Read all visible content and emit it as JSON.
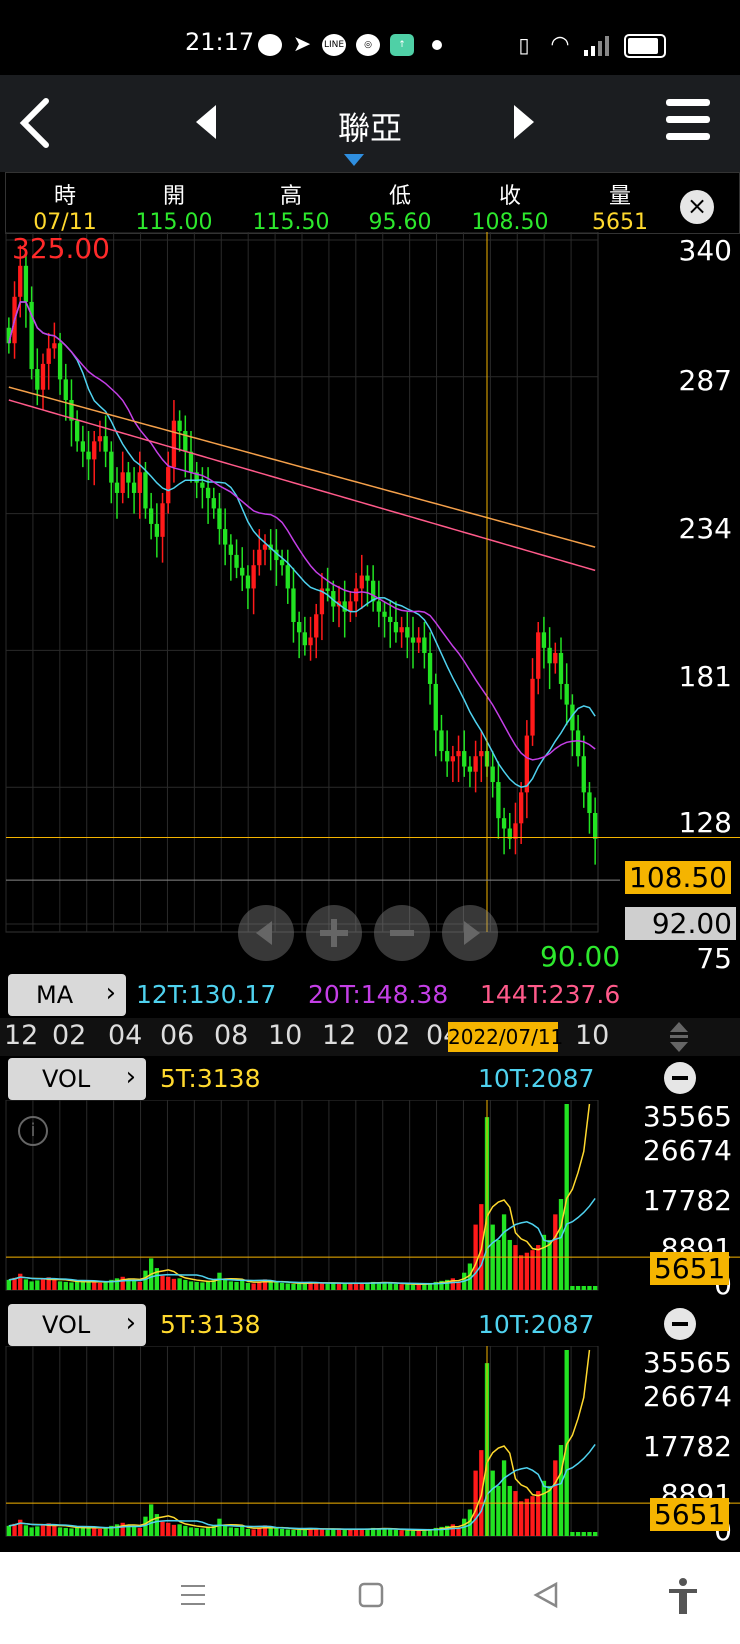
{
  "status_bar": {
    "time": "21:17",
    "icons": [
      "discord-icon",
      "telegram-icon",
      "line-icon",
      "app-icon",
      "green-app-icon",
      "dot-icon",
      "vibrate-icon",
      "wifi-icon",
      "signal-icon",
      "battery-icon"
    ]
  },
  "nav": {
    "title": "聯亞",
    "back_icon": "back-chevron-icon",
    "prev_icon": "prev-triangle-icon",
    "next_icon": "next-triangle-icon",
    "menu_icon": "hamburger-menu-icon"
  },
  "quote": {
    "headers": [
      "時",
      "開",
      "高",
      "低",
      "收",
      "量"
    ],
    "values": [
      "07/11",
      "115.00",
      "115.50",
      "95.60",
      "108.50",
      "5651"
    ],
    "value_colors": [
      "#ffd92e",
      "#2de82d",
      "#2de82d",
      "#2de82d",
      "#2de82d",
      "#ffd92e"
    ]
  },
  "chart": {
    "max_label": "325.00",
    "min_label": "90.00",
    "yaxis": [
      "340",
      "287",
      "234",
      "181",
      "128",
      "75"
    ],
    "price_tag": "108.50",
    "cursor_tag": "92.00",
    "xaxis": [
      "12",
      "02",
      "04",
      "06",
      "08",
      "10",
      "12",
      "02",
      "04",
      "10"
    ],
    "cursor_date": "2022/07/11"
  },
  "ma": {
    "button": "MA",
    "ma12": "12T:130.17",
    "ma20": "20T:148.38",
    "ma144": "144T:237.6",
    "color12": "#4fd2ef",
    "color20": "#c43fe6",
    "color144": "#ff5a8a"
  },
  "vol1": {
    "button": "VOL",
    "ma5": "5T:3138",
    "ma10": "10T:2087",
    "axis": [
      "35565",
      "26674",
      "17782",
      "8891",
      "0"
    ],
    "tag": "5651"
  },
  "vol2": {
    "button": "VOL",
    "ma5": "5T:3138",
    "ma10": "10T:2087",
    "axis": [
      "35565",
      "26674",
      "17782",
      "8891",
      "0"
    ],
    "tag": "5651"
  },
  "bottom_nav": [
    "menu-lines-icon",
    "home-square-icon",
    "back-triangle-icon",
    "accessibility-icon"
  ],
  "colors": {
    "up": "#ff1a1a",
    "down": "#22e322",
    "accent": "#f5b400"
  },
  "chart_data": {
    "type": "candlestick",
    "title": "聯亞",
    "ylim": [
      75,
      340
    ],
    "close": [
      300,
      318,
      330,
      316,
      290,
      282,
      292,
      298,
      300,
      286,
      278,
      270,
      262,
      258,
      255,
      262,
      264,
      258,
      246,
      242,
      250,
      246,
      242,
      250,
      236,
      230,
      225,
      238,
      252,
      270,
      266,
      258,
      250,
      246,
      244,
      240,
      236,
      228,
      222,
      218,
      213,
      210,
      205,
      214,
      220,
      222,
      220,
      216,
      214,
      205,
      192,
      188,
      183,
      186,
      195,
      205,
      204,
      198,
      200,
      196,
      200,
      205,
      210,
      208,
      200,
      196,
      194,
      192,
      188,
      190,
      186,
      184,
      186,
      180,
      168,
      150,
      142,
      138,
      140,
      142,
      136,
      134,
      140,
      142,
      136,
      130,
      116,
      112,
      108,
      114,
      126,
      148,
      170,
      188,
      182,
      176,
      180,
      168,
      160,
      150,
      140,
      126,
      118,
      108
    ],
    "volume": [
      1200,
      1600,
      2400,
      1300,
      900,
      1100,
      1500,
      1700,
      1200,
      900,
      800,
      700,
      900,
      1000,
      800,
      700,
      600,
      900,
      1200,
      1500,
      1800,
      1400,
      1000,
      800,
      3000,
      5400,
      3500,
      2000,
      1800,
      1400,
      1500,
      1200,
      900,
      800,
      700,
      900,
      1400,
      2600,
      1300,
      900,
      800,
      1000,
      600,
      500,
      900,
      1300,
      800,
      700,
      600,
      500,
      400,
      450,
      600,
      800,
      700,
      500,
      400,
      600,
      700,
      500,
      400,
      500,
      600,
      700,
      800,
      600,
      700,
      500,
      400,
      350,
      300,
      250,
      350,
      400,
      600,
      800,
      1000,
      1200,
      1500,
      800,
      2600,
      4400,
      12000,
      16000,
      33000,
      12000,
      9000,
      14000,
      9000,
      8000,
      6000,
      6500,
      7000,
      8000,
      10000,
      9000,
      14000,
      17000,
      35565
    ],
    "ma_labels": [
      "12T:130.17",
      "20T:148.38",
      "144T:237.6"
    ]
  }
}
